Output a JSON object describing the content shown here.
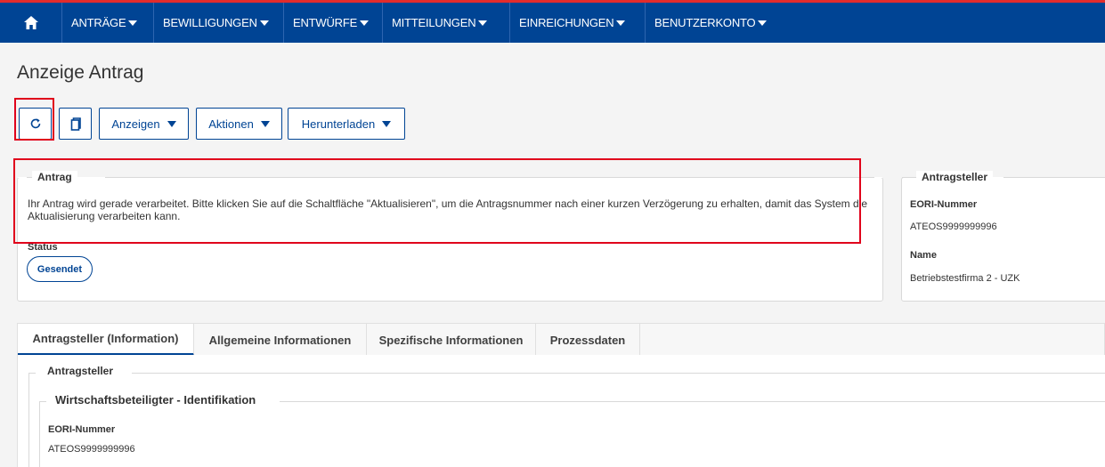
{
  "nav": {
    "items": [
      "ANTRÄGE",
      "BEWILLIGUNGEN",
      "ENTWÜRFE",
      "MITTEILUNGEN",
      "EINREICHUNGEN",
      "BENUTZERKONTO"
    ]
  },
  "page": {
    "title": "Anzeige Antrag"
  },
  "toolbar": {
    "anzeigen": "Anzeigen",
    "aktionen": "Aktionen",
    "herunterladen": "Herunterladen"
  },
  "antrag": {
    "legend": "Antrag",
    "message": "Ihr Antrag wird gerade verarbeitet. Bitte klicken Sie auf die Schaltfläche \"Aktualisieren\", um die Antragsnummer nach einer kurzen Verzögerung zu erhalten, damit das System die Aktualisierung verarbeiten kann.",
    "status_label": "Status",
    "status_value": "Gesendet"
  },
  "antragsteller_panel": {
    "legend": "Antragsteller",
    "eori_label": "EORI-Nummer",
    "eori_value": "ATEOS9999999996",
    "name_label": "Name",
    "name_value": "Betriebstestfirma 2 - UZK"
  },
  "tabs": [
    "Antragsteller (Information)",
    "Allgemeine Informationen",
    "Spezifische Informationen",
    "Prozessdaten"
  ],
  "details": {
    "legend": "Antragsteller",
    "sublegend": "Wirtschaftsbeteiligter - Identifikation",
    "eori_label": "EORI-Nummer",
    "eori_value": "ATEOS9999999996"
  },
  "colors": {
    "nav_bg": "#004494",
    "accent": "#004494",
    "highlight": "#e0001b"
  }
}
